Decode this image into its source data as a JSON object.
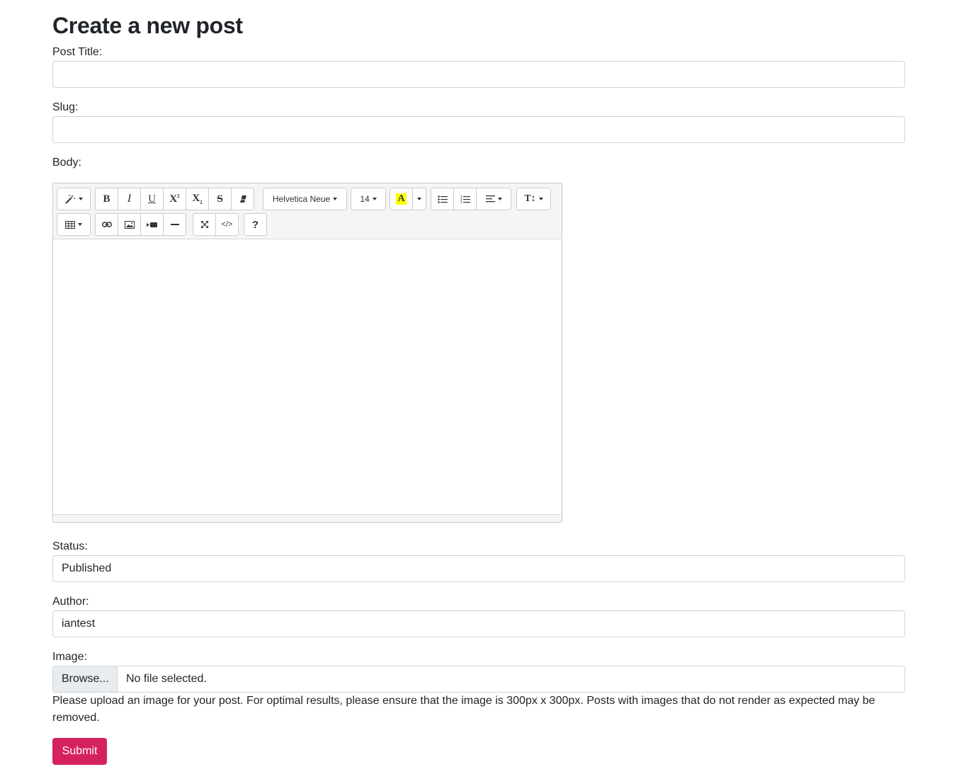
{
  "page": {
    "title": "Create a new post"
  },
  "form": {
    "title_label": "Post Title:",
    "title_value": "",
    "slug_label": "Slug:",
    "slug_value": "",
    "body_label": "Body:",
    "status_label": "Status:",
    "status_value": "Published",
    "author_label": "Author:",
    "author_value": "iantest",
    "image_label": "Image:",
    "browse_label": "Browse...",
    "file_status": "No file selected.",
    "help_text": "Please upload an image for your post. For optimal results, please ensure that the image is 300px x 300px. Posts with images that do not render as expected may be removed.",
    "submit_label": "Submit"
  },
  "editor": {
    "font_name": "Helvetica Neue",
    "font_size": "14",
    "highlight_letter": "A",
    "help_label": "?",
    "code_label": "</>",
    "bold_label": "B",
    "italic_label": "I",
    "underline_label": "U",
    "superscript_label": "X",
    "subscript_label": "X",
    "strike_label": "S",
    "line_height_label": "T↕",
    "highlight_color": "#ffff00"
  },
  "colors": {
    "submit_bg": "#d6215f"
  }
}
